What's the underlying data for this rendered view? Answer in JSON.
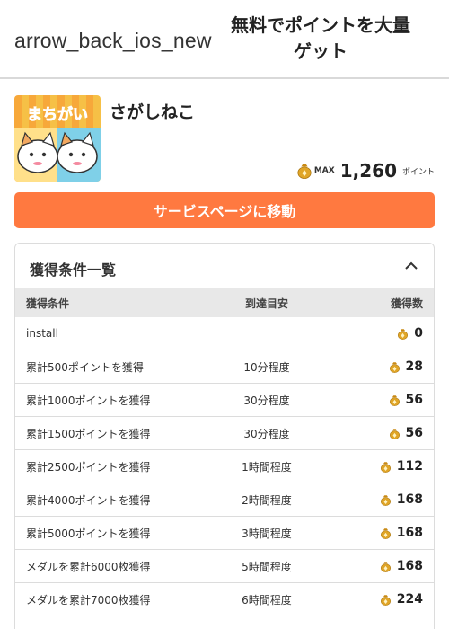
{
  "header": {
    "back_icon_text": "arrow_back_ios_new",
    "title": "無料でポイントを大量ゲット"
  },
  "app": {
    "name": "さがしねこ",
    "icon_text": "まちがい",
    "max_label": "MAX",
    "max_points": "1,260",
    "points_unit": "ポイント",
    "service_button": "サービスページに移動"
  },
  "conditions": {
    "title": "獲得条件一覧",
    "columns": [
      "獲得条件",
      "到達目安",
      "獲得数"
    ],
    "rows": [
      {
        "condition": "install",
        "estimate": "",
        "points": "0"
      },
      {
        "condition": "累計500ポイントを獲得",
        "estimate": "10分程度",
        "points": "28"
      },
      {
        "condition": "累計1000ポイントを獲得",
        "estimate": "30分程度",
        "points": "56"
      },
      {
        "condition": "累計1500ポイントを獲得",
        "estimate": "30分程度",
        "points": "56"
      },
      {
        "condition": "累計2500ポイントを獲得",
        "estimate": "1時間程度",
        "points": "112"
      },
      {
        "condition": "累計4000ポイントを獲得",
        "estimate": "2時間程度",
        "points": "168"
      },
      {
        "condition": "累計5000ポイントを獲得",
        "estimate": "3時間程度",
        "points": "168"
      },
      {
        "condition": "メダルを累計6000枚獲得",
        "estimate": "5時間程度",
        "points": "168"
      },
      {
        "condition": "メダルを累計7000枚獲得",
        "estimate": "6時間程度",
        "points": "224"
      }
    ]
  },
  "colors": {
    "accent": "#ff7940",
    "table_header_bg": "#e8e8e8",
    "coin": "#e0a527"
  },
  "icons": {
    "back": "arrow-back-icon",
    "coin": "coin-bag-icon",
    "collapse": "chevron-up-icon"
  }
}
